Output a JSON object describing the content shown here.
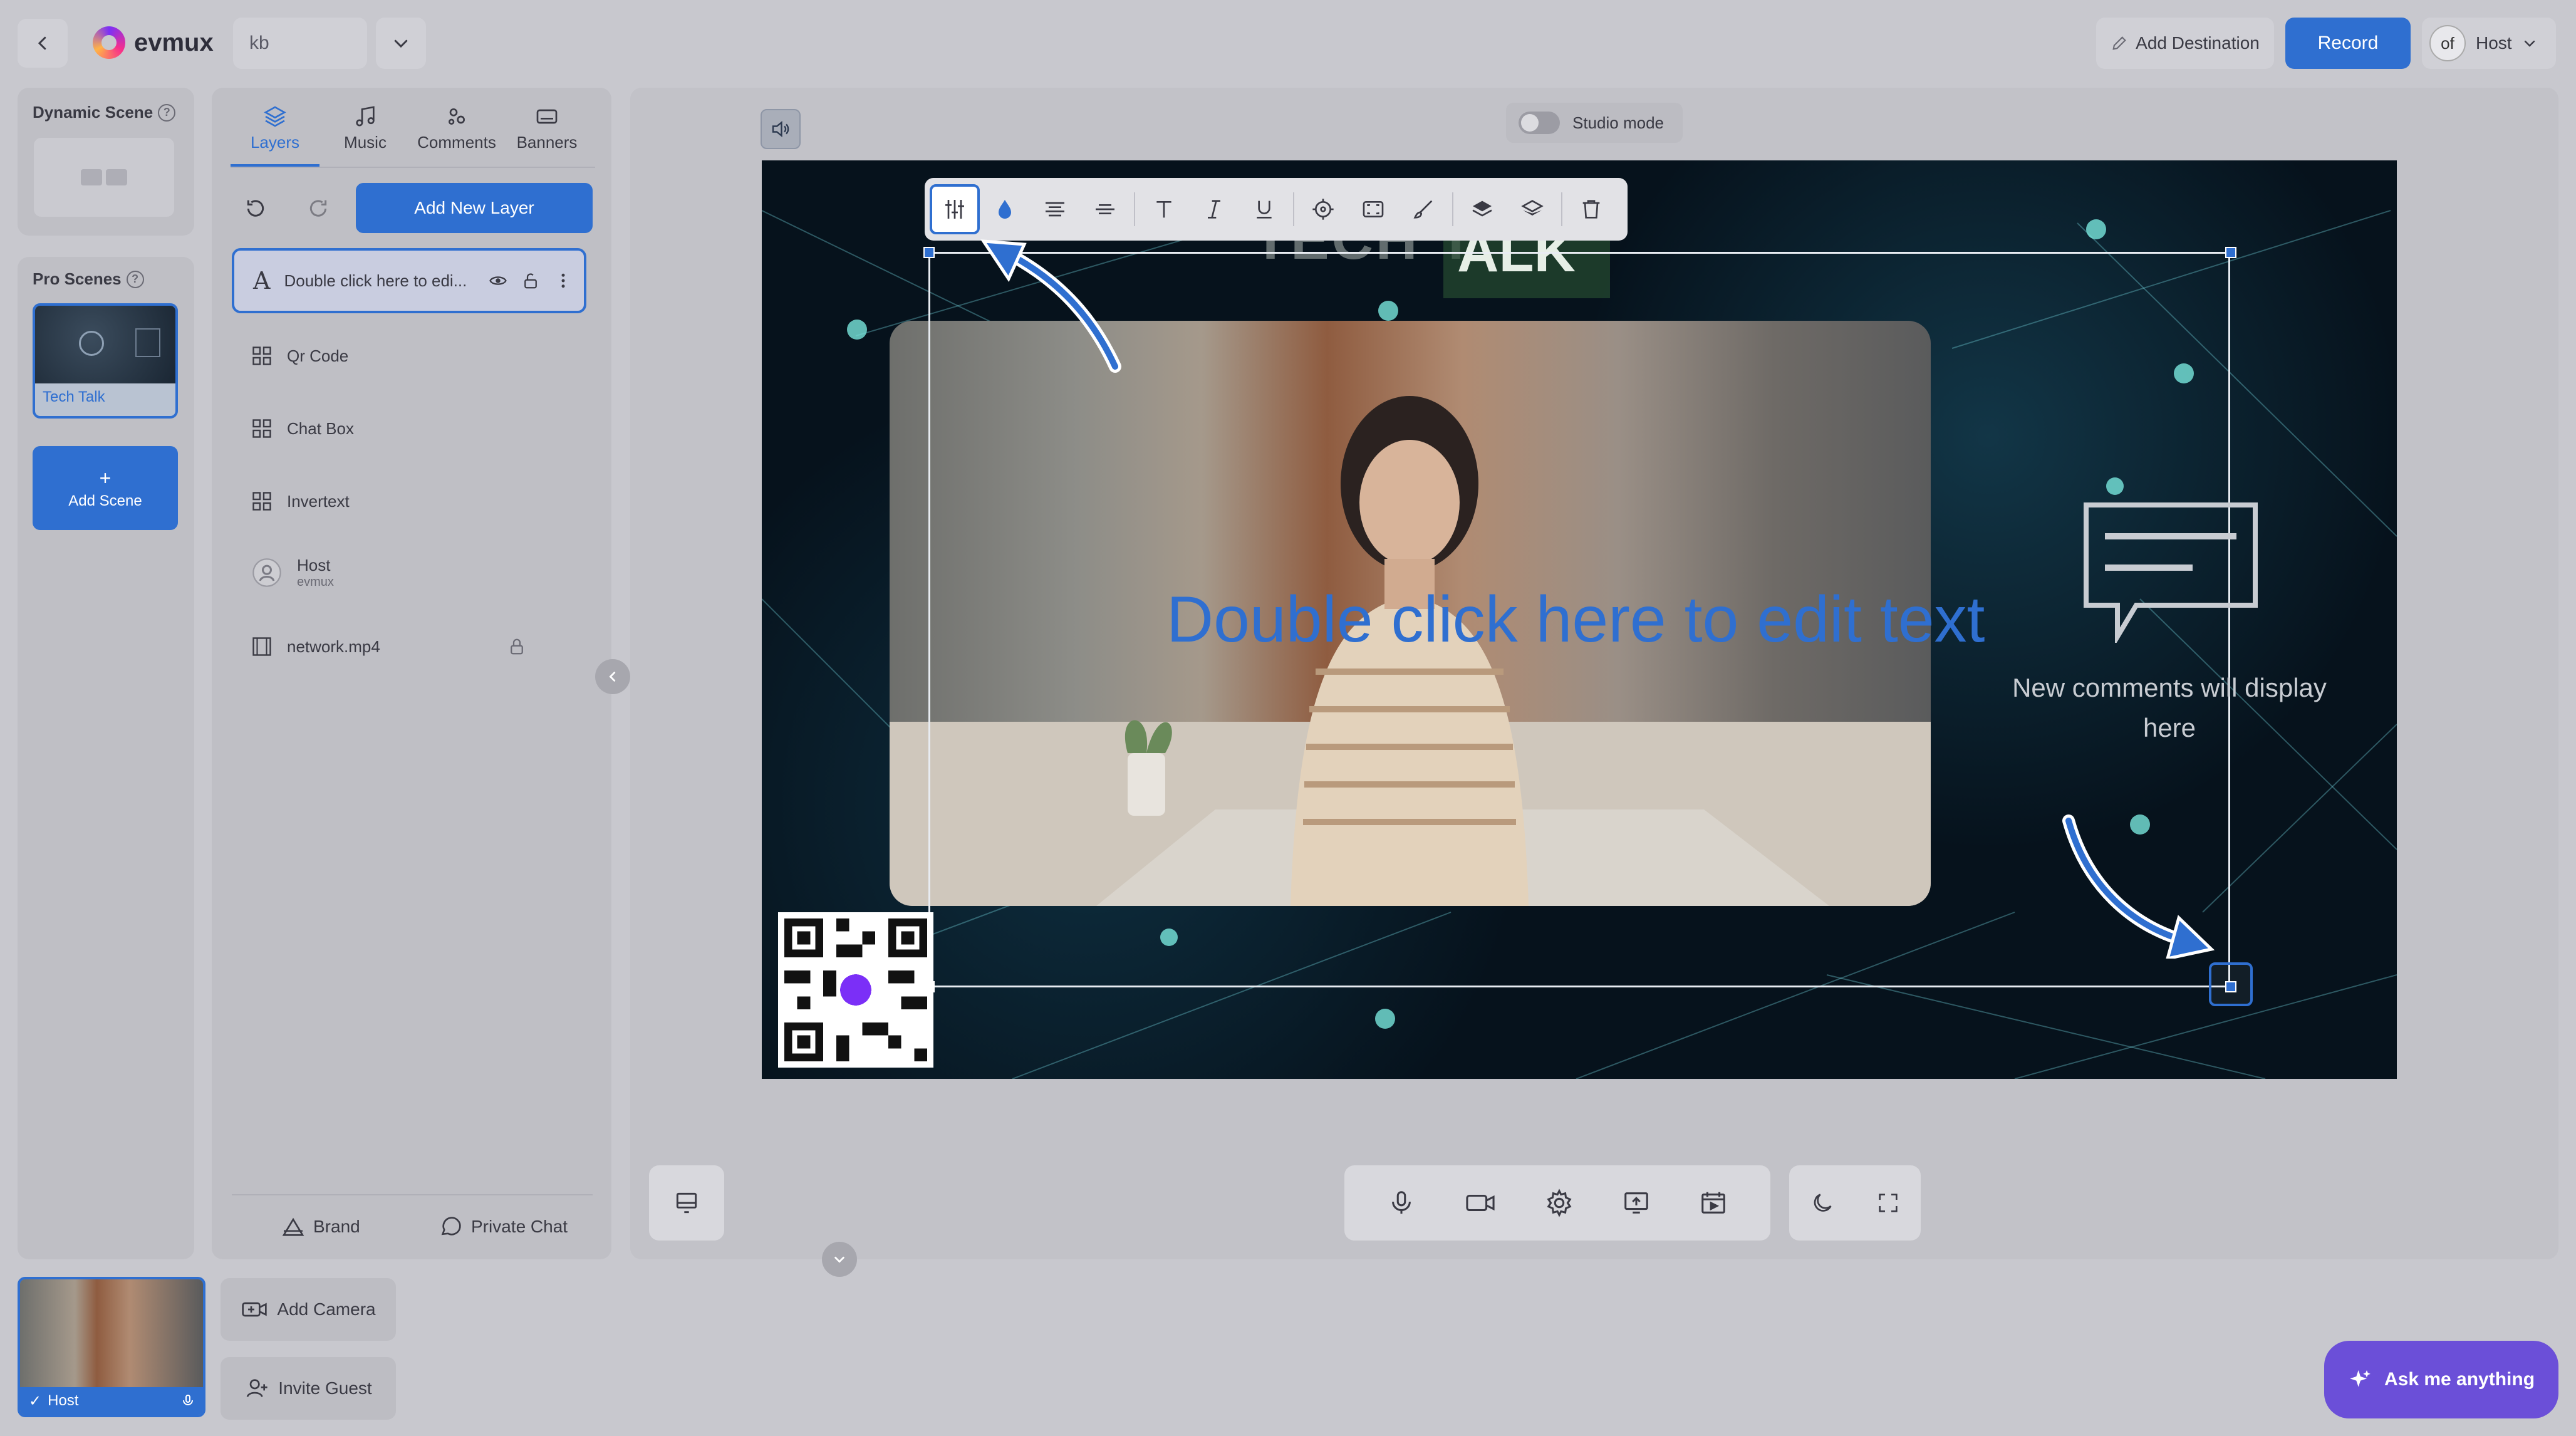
{
  "header": {
    "app_name": "evmux",
    "room_name": "kb",
    "add_destination": "Add Destination",
    "record": "Record",
    "user_initials": "of",
    "user_name": "Host"
  },
  "scenes": {
    "dynamic_title": "Dynamic Scene",
    "pro_title": "Pro Scenes",
    "pro_items": [
      {
        "label": "Tech Talk"
      }
    ],
    "add_scene_plus": "+",
    "add_scene": "Add Scene"
  },
  "layers_panel": {
    "tabs": [
      {
        "label": "Layers",
        "icon": "layers-icon",
        "active": true
      },
      {
        "label": "Music",
        "icon": "music-icon"
      },
      {
        "label": "Comments",
        "icon": "comments-icon"
      },
      {
        "label": "Banners",
        "icon": "banners-icon"
      }
    ],
    "add_layer": "Add New Layer",
    "layers": [
      {
        "label": "Double click here to edi...",
        "icon": "text-icon",
        "selected": true
      },
      {
        "label": "Qr Code",
        "icon": "widget-icon"
      },
      {
        "label": "Chat Box",
        "icon": "widget-icon"
      },
      {
        "label": "Invertext",
        "icon": "widget-icon"
      },
      {
        "label": "Host",
        "sub": "evmux",
        "icon": "avatar-icon"
      },
      {
        "label": "network.mp4",
        "icon": "video-file-icon",
        "locked": true
      }
    ],
    "footer": {
      "brand": "Brand",
      "private_chat": "Private Chat"
    }
  },
  "stage": {
    "studio_mode": "Studio mode",
    "title_part_1": "TECH T",
    "title_part_2": "ALK",
    "edit_text": "Double click here to edit text",
    "comments_placeholder": "New comments will display here"
  },
  "bottom": {
    "host_label": "Host",
    "add_camera": "Add Camera",
    "invite_guest": "Invite Guest",
    "ask": "Ask me anything"
  },
  "colors": {
    "accent": "#2f6fd0",
    "ask_button": "#6b4fd8"
  }
}
